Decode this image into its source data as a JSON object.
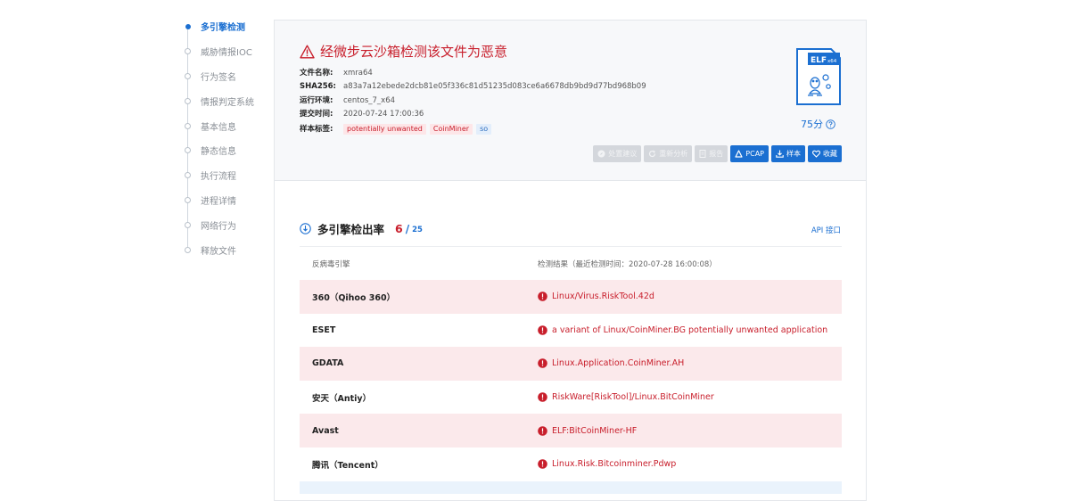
{
  "nav": {
    "items": [
      {
        "label": "多引擎检测",
        "active": true
      },
      {
        "label": "威胁情报IOC"
      },
      {
        "label": "行为签名"
      },
      {
        "label": "情报判定系统"
      },
      {
        "label": "基本信息"
      },
      {
        "label": "静态信息"
      },
      {
        "label": "执行流程"
      },
      {
        "label": "进程详情"
      },
      {
        "label": "网络行为"
      },
      {
        "label": "释放文件"
      }
    ]
  },
  "summary": {
    "verdict": "经微步云沙箱检测该文件为恶意",
    "fields": [
      {
        "key": "文件名称:",
        "value": "xmra64"
      },
      {
        "key": "SHA256:",
        "value": "a83a7a12ebede2dcb81e05f336c81d51235d083ce6a6678db9bd9d77bd968b09"
      },
      {
        "key": "运行环境:",
        "value": "centos_7_x64"
      },
      {
        "key": "提交时间:",
        "value": "2020-07-24 17:00:36"
      }
    ],
    "tags_key": "样本标签:",
    "tags": [
      "potentially unwanted",
      "CoinMiner",
      "so"
    ],
    "file_type": "ELF",
    "file_arch": "x64",
    "score": "75分",
    "actions": {
      "advice": "处置建议",
      "reanalyze": "重新分析",
      "report": "报告",
      "pcap": "PCAP",
      "sample": "样本",
      "favorite": "收藏"
    }
  },
  "detection": {
    "title": "多引擎检出率",
    "hits": "6",
    "slash": "/",
    "total": "25",
    "api": "API 接口",
    "columns": {
      "engine": "反病毒引擎",
      "result": "检测结果（最近检测时间：2020-07-28 16:00:08）"
    },
    "rows": [
      {
        "engine": "360（Qihoo 360）",
        "result": "Linux/Virus.RiskTool.42d"
      },
      {
        "engine": "ESET",
        "result": "a variant of Linux/CoinMiner.BG potentially unwanted application"
      },
      {
        "engine": "GDATA",
        "result": "Linux.Application.CoinMiner.AH"
      },
      {
        "engine": "安天（Antiy）",
        "result": "RiskWare[RiskTool]/Linux.BitCoinMiner"
      },
      {
        "engine": "Avast",
        "result": "ELF:BitCoinMiner-HF"
      },
      {
        "engine": "腾讯（Tencent）",
        "result": "Linux.Risk.Bitcoinminer.Pdwp"
      }
    ]
  },
  "colors": {
    "accent": "#1b6fd1",
    "danger": "#c81e2b",
    "row_highlight": "#fbe9eb"
  }
}
